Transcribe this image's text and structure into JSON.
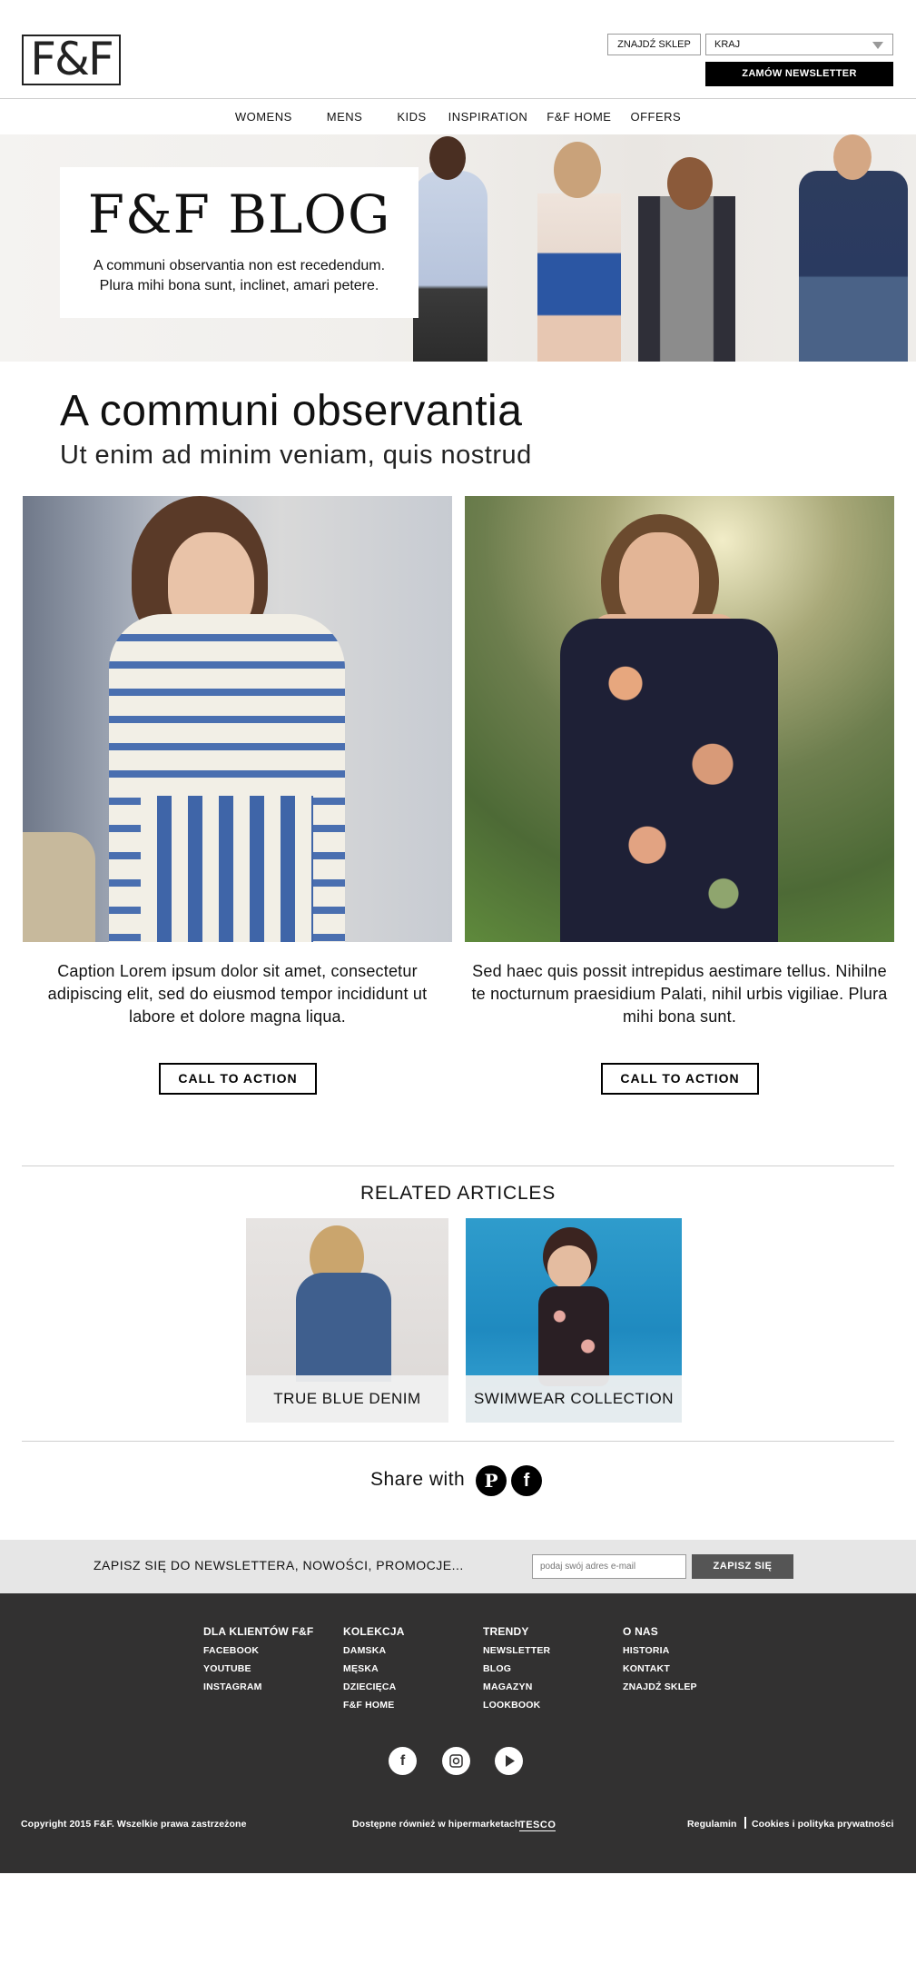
{
  "header": {
    "logo": "F&F",
    "find_store": "ZNAJDŹ SKLEP",
    "country": "KRAJ",
    "newsletter_btn": "ZAMÓW NEWSLETTER"
  },
  "nav": [
    "WOMENS",
    "MENS",
    "KIDS",
    "INSPIRATION",
    "F&F HOME",
    "OFFERS"
  ],
  "hero": {
    "title": "F&F BLOG",
    "line1": "A communi observantia non est recedendum.",
    "line2": "Plura mihi bona sunt, inclinet, amari petere."
  },
  "article": {
    "title": "A communi observantia",
    "subtitle": "Ut enim ad minim veniam, quis nostrud",
    "left_caption": "Caption Lorem ipsum dolor sit amet, consectetur adipiscing elit, sed do eiusmod tempor incididunt ut labore et dolore magna liqua.",
    "right_caption": "Sed haec quis possit intrepidus aestimare tellus. Nihilne te nocturnum praesidium Palati, nihil urbis vigiliae. Plura mihi bona sunt.",
    "cta_left": "CALL TO ACTION",
    "cta_right": "CALL TO ACTION"
  },
  "related": {
    "title": "RELATED ARTICLES",
    "items": [
      {
        "label": "TRUE BLUE DENIM"
      },
      {
        "label": "SWIMWEAR COLLECTION"
      }
    ]
  },
  "share": {
    "label": "Share with",
    "icons": [
      "pinterest-icon",
      "facebook-icon"
    ]
  },
  "newsletter": {
    "text": "ZAPISZ SIĘ DO NEWSLETTERA, NOWOŚCI, PROMOCJE...",
    "placeholder": "podaj swój adres e-mail",
    "button": "ZAPISZ SIĘ"
  },
  "footer": {
    "columns": [
      {
        "heading": "DLA KLIENTÓW F&F",
        "links": [
          "FACEBOOK",
          "YOUTUBE",
          "INSTAGRAM"
        ]
      },
      {
        "heading": "KOLEKCJA",
        "links": [
          "DAMSKA",
          "MĘSKA",
          "DZIECIĘCA",
          "F&F HOME"
        ]
      },
      {
        "heading": "TRENDY",
        "links": [
          "NEWSLETTER",
          "BLOG",
          "MAGAZYN",
          "LOOKBOOK"
        ]
      },
      {
        "heading": "O NAS",
        "links": [
          "HISTORIA",
          "KONTAKT",
          "ZNAJDŹ SKLEP"
        ]
      }
    ],
    "social_icons": [
      "facebook-icon",
      "instagram-icon",
      "youtube-icon"
    ],
    "copyright": "Copyright 2015 F&F. Wszelkie prawa zastrzeżone",
    "available": "Dostępne również w hipermarketach",
    "tesco": "TESCO",
    "terms": "Regulamin",
    "cookies": "Cookies i polityka prywatności"
  },
  "colors": {
    "footer_bg": "#323131",
    "band_bg": "#e6e6e6",
    "button_black": "#000000"
  }
}
